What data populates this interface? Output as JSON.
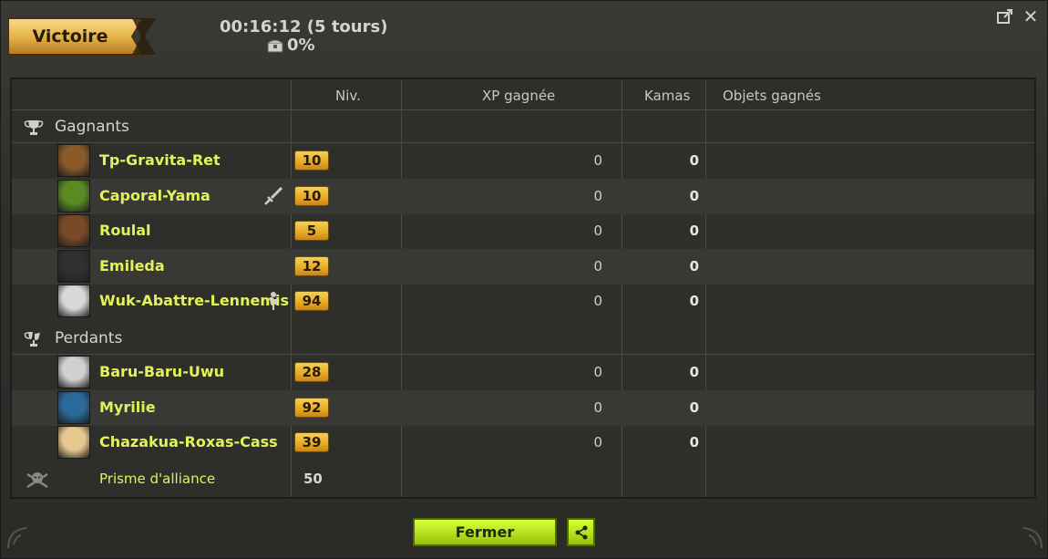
{
  "header": {
    "result": "Victoire",
    "fight_time": "00:16:12 (5 tours)",
    "progress_percent": "0%"
  },
  "window_controls": [
    {
      "name": "detach-icon"
    },
    {
      "name": "close-icon"
    }
  ],
  "columns": {
    "niv": "Niv.",
    "xp": "XP gagnée",
    "kamas": "Kamas",
    "objects": "Objets gagnés"
  },
  "groups": {
    "winners_label": "Gagnants",
    "losers_label": "Perdants"
  },
  "winners": [
    {
      "name": "Tp-Gravita-Ret",
      "level": "10",
      "xp": "0",
      "kamas": "0",
      "avatar_color": "#8a5a2a"
    },
    {
      "name": "Caporal-Yama",
      "level": "10",
      "xp": "0",
      "kamas": "0",
      "avatar_color": "#5a8a20",
      "extra_icon": "sword-icon"
    },
    {
      "name": "Roulal",
      "level": "5",
      "xp": "0",
      "kamas": "0",
      "avatar_color": "#7a4a28"
    },
    {
      "name": "Emileda",
      "level": "12",
      "xp": "0",
      "kamas": "0",
      "avatar_color": "#303030"
    },
    {
      "name": "Wuk-Abattre-Lennemis",
      "level": "94",
      "xp": "0",
      "kamas": "0",
      "avatar_color": "#d8d8d8",
      "extra_icon": "player-icon"
    }
  ],
  "losers": [
    {
      "name": "Baru-Baru-Uwu",
      "level": "28",
      "xp": "0",
      "kamas": "0",
      "avatar_color": "#d0d0d0"
    },
    {
      "name": "Myrilie",
      "level": "92",
      "xp": "0",
      "kamas": "0",
      "avatar_color": "#2a6a9a"
    },
    {
      "name": "Chazakua-Roxas-Cass",
      "level": "39",
      "xp": "0",
      "kamas": "0",
      "avatar_color": "#e8c890"
    }
  ],
  "prism": {
    "label": "Prisme d'alliance",
    "level": "50"
  },
  "buttons": {
    "close": "Fermer"
  },
  "colors": {
    "player_name": "#e2f25a",
    "level_badge": "#e6a922",
    "button": "#b4e01d"
  }
}
